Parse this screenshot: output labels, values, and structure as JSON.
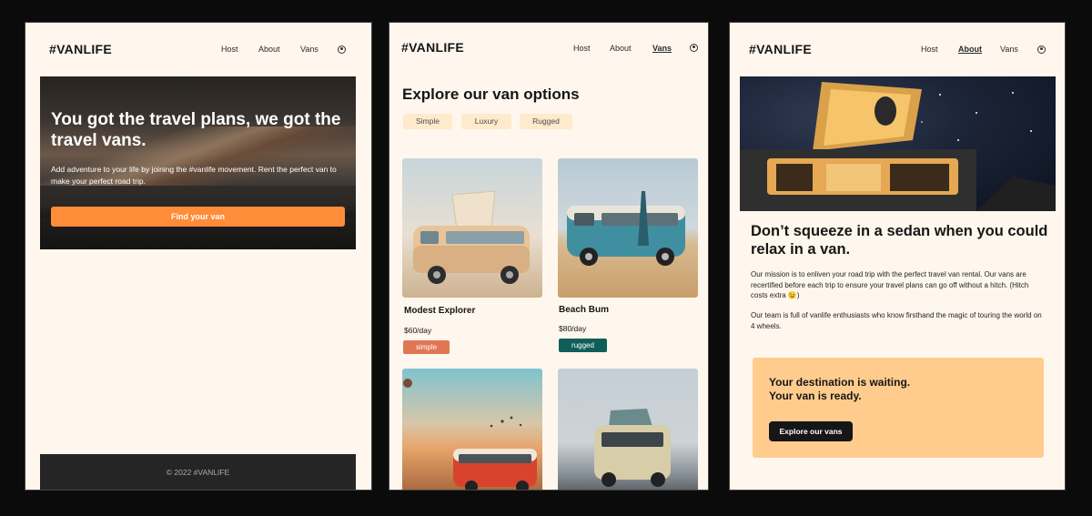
{
  "brand": "#VANLIFE",
  "nav": {
    "host": "Host",
    "about": "About",
    "vans": "Vans"
  },
  "home": {
    "hero_title": "You got the travel plans, we got the travel vans.",
    "hero_text": "Add adventure to your life by joining the #vanlife movement. Rent the perfect van to make your perfect road trip.",
    "cta": "Find your van",
    "footer": "© 2022 #VANLIFE"
  },
  "vans_page": {
    "title": "Explore our van options",
    "filters": [
      "Simple",
      "Luxury",
      "Rugged"
    ],
    "vans": [
      {
        "name": "Modest Explorer",
        "price": "$60/day",
        "type": "simple",
        "type_color": "#e17654"
      },
      {
        "name": "Beach Bum",
        "price": "$80/day",
        "type": "rugged",
        "type_color": "#115e59"
      }
    ]
  },
  "about": {
    "title": "Don’t squeeze in a sedan when you could relax in a van.",
    "p1": "Our mission is to enliven your road trip with the perfect travel van rental. Our vans are recertified before each trip to ensure your travel plans can go off without a hitch. (Hitch costs extra 😉)",
    "p2": "Our team is full of vanlife enthusiasts who know firsthand the magic of touring the world on 4 wheels.",
    "cta_line1": "Your destination is waiting.",
    "cta_line2": "Your van is ready.",
    "cta_button": "Explore our vans"
  },
  "colors": {
    "background": "#fff7ed",
    "orange": "#ff8c38",
    "peach": "#ffcc8d",
    "chip": "#ffeacc",
    "dark": "#161616"
  },
  "icons": [
    "user-circle-icon"
  ]
}
